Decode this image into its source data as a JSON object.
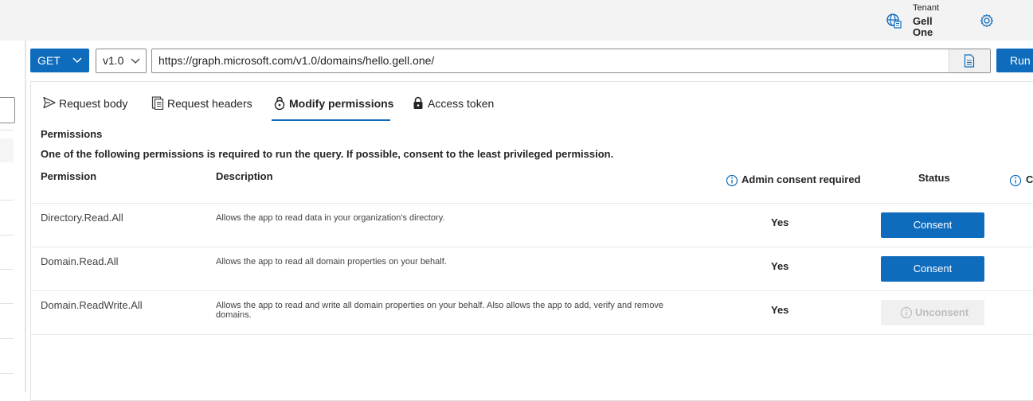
{
  "header": {
    "tenant_label": "Tenant",
    "tenant_name": "Gell One"
  },
  "query": {
    "method": "GET",
    "version": "v1.0",
    "url": "https://graph.microsoft.com/v1.0/domains/hello.gell.one/",
    "run_label": "Run"
  },
  "tabs": [
    {
      "label": "Request body",
      "icon": "send-icon"
    },
    {
      "label": "Request headers",
      "icon": "document-list-icon"
    },
    {
      "label": "Modify permissions",
      "icon": "lock-shield-icon",
      "active": true
    },
    {
      "label": "Access token",
      "icon": "lock-icon"
    }
  ],
  "permissions": {
    "title": "Permissions",
    "note": "One of the following permissions is required to run the query. If possible, consent to the least privileged permission.",
    "columns": {
      "permission": "Permission",
      "description": "Description",
      "admin": "Admin consent required",
      "status": "Status",
      "extra": "C"
    },
    "rows": [
      {
        "permission": "Directory.Read.All",
        "description": "Allows the app to read data in your organization's directory.",
        "admin": "Yes",
        "action": "Consent"
      },
      {
        "permission": "Domain.Read.All",
        "description": "Allows the app to read all domain properties on your behalf.",
        "admin": "Yes",
        "action": "Consent"
      },
      {
        "permission": "Domain.ReadWrite.All",
        "description": "Allows the app to read and write all domain properties on your behalf. Also allows the app to add, verify and remove domains.",
        "admin": "Yes",
        "action": "Unconsent"
      }
    ]
  },
  "colors": {
    "accent": "#0f6cbd",
    "topbar": "#f3f3f3",
    "disabled": "#f0f0f0"
  }
}
